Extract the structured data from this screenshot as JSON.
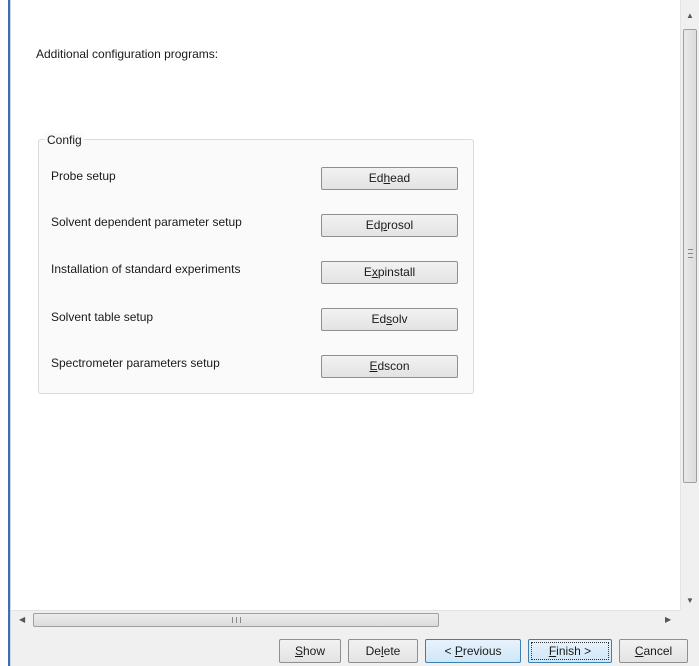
{
  "heading": "Additional configuration programs:",
  "config_group": {
    "title": "Config",
    "rows": [
      {
        "label": "Probe setup",
        "button_pre": "Ed",
        "button_mnemonic": "h",
        "button_post": "ead"
      },
      {
        "label": "Solvent dependent parameter setup",
        "button_pre": "Ed",
        "button_mnemonic": "p",
        "button_post": "rosol"
      },
      {
        "label": "Installation of standard experiments",
        "button_pre": "E",
        "button_mnemonic": "x",
        "button_post": "pinstall"
      },
      {
        "label": "Solvent table setup",
        "button_pre": "Ed",
        "button_mnemonic": "s",
        "button_post": "olv"
      },
      {
        "label": "Spectrometer parameters setup",
        "button_pre": "",
        "button_mnemonic": "E",
        "button_post": "dscon"
      }
    ]
  },
  "footer": {
    "show": {
      "pre": "",
      "mnemonic": "S",
      "post": "how"
    },
    "delete": {
      "pre": "De",
      "mnemonic": "l",
      "post": "ete"
    },
    "previous": {
      "pre": "< ",
      "mnemonic": "P",
      "post": "revious"
    },
    "finish": {
      "pre": "",
      "mnemonic": "F",
      "post": "inish >"
    },
    "cancel": {
      "pre": "",
      "mnemonic": "C",
      "post": "ancel"
    }
  },
  "icons": {
    "scroll_up": "scroll-up-arrow-icon",
    "scroll_down": "scroll-down-arrow-icon",
    "scroll_left": "scroll-left-arrow-icon",
    "scroll_right": "scroll-right-arrow-icon"
  },
  "colors": {
    "window_border": "#3b6fb0",
    "primary_button_border": "#3c7fb1",
    "panel_background": "#f0f0f0"
  }
}
